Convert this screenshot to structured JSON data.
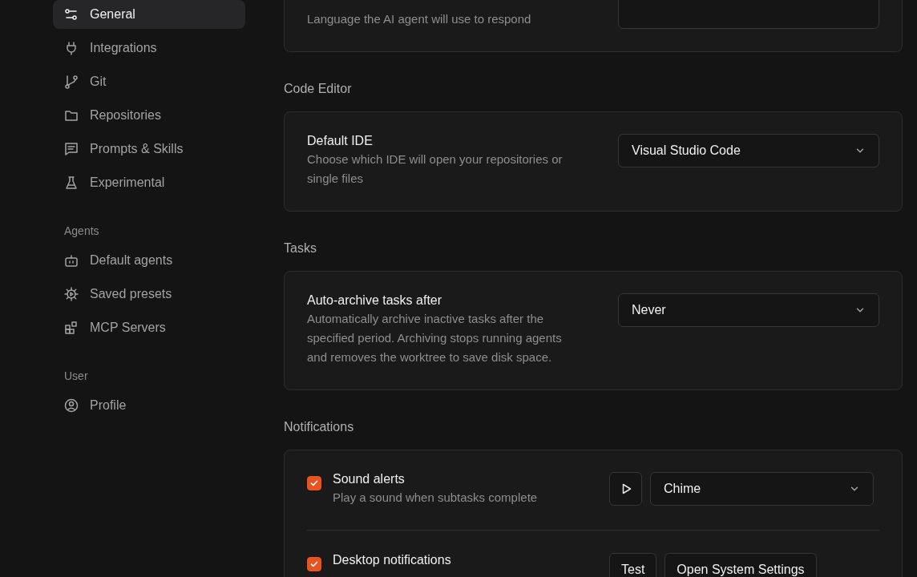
{
  "sidebar": {
    "groups": [
      {
        "items": [
          {
            "label": "General",
            "selected": true
          },
          {
            "label": "Integrations",
            "selected": false
          },
          {
            "label": "Git",
            "selected": false
          },
          {
            "label": "Repositories",
            "selected": false
          },
          {
            "label": "Prompts & Skills",
            "selected": false
          },
          {
            "label": "Experimental",
            "selected": false
          }
        ]
      },
      {
        "heading": "Agents",
        "items": [
          {
            "label": "Default agents",
            "selected": false
          },
          {
            "label": "Saved presets",
            "selected": false
          },
          {
            "label": "MCP Servers",
            "selected": false
          }
        ]
      },
      {
        "heading": "User",
        "items": [
          {
            "label": "Profile",
            "selected": false
          }
        ]
      }
    ]
  },
  "sections": [
    {
      "settings": [
        {
          "description": "Language the AI agent will use to respond"
        }
      ]
    },
    {
      "heading": "Code Editor",
      "settings": [
        {
          "label": "Default IDE",
          "description": "Choose which IDE will open your repositories or single files",
          "select": {
            "value": "Visual Studio Code"
          }
        }
      ]
    },
    {
      "heading": "Tasks",
      "settings": [
        {
          "label": "Auto-archive tasks after",
          "description": "Automatically archive inactive tasks after the specified period. Archiving stops running agents and removes the worktree to save disk space.",
          "select": {
            "value": "Never"
          }
        }
      ]
    }
  ],
  "notifications": {
    "heading": "Notifications",
    "items": [
      {
        "kind": "sound",
        "label": "Sound alerts",
        "checked": true,
        "description": "Play a sound when subtasks complete",
        "select": {
          "value": "Chime"
        }
      },
      {
        "kind": "desktop",
        "label": "Desktop notifications",
        "checked": true,
        "buttons": [
          "Test",
          "Open System Settings"
        ]
      }
    ]
  }
}
